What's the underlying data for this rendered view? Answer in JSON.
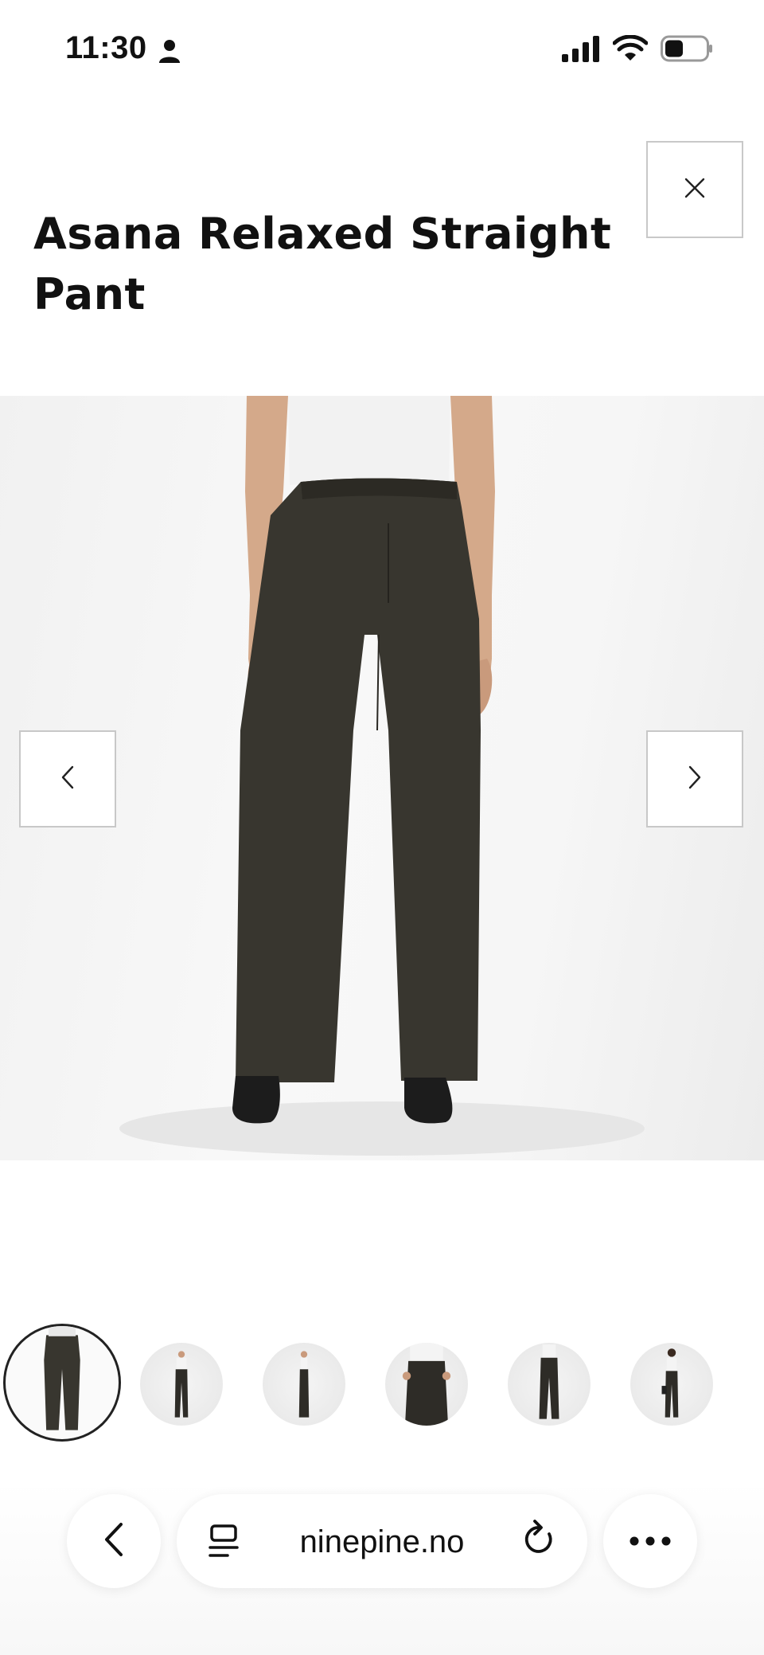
{
  "status_bar": {
    "time": "11:30",
    "icons": [
      "person-icon",
      "signal-icon",
      "wifi-icon",
      "battery-icon"
    ]
  },
  "product": {
    "title": "Asana Relaxed Straight Pant",
    "close_icon": "close-icon"
  },
  "gallery": {
    "prev_icon": "chevron-left-icon",
    "next_icon": "chevron-right-icon",
    "active_index": 0,
    "thumbnail_count": 6
  },
  "browser": {
    "url": "ninepine.no",
    "back_icon": "chevron-left-icon",
    "reader_icon": "page-menu-icon",
    "reload_icon": "reload-icon",
    "more_icon": "more-icon"
  },
  "colors": {
    "pant": "#38362f",
    "border": "#c8c8c8",
    "text": "#111111"
  }
}
